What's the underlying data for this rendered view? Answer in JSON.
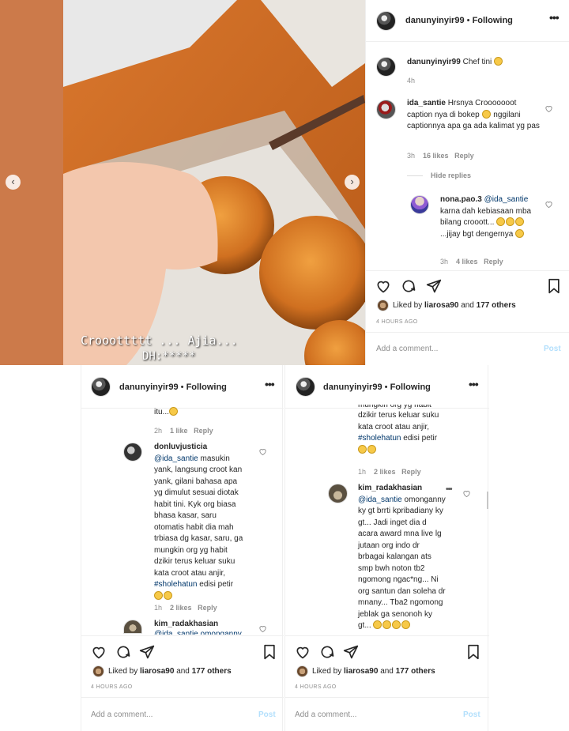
{
  "post_top": {
    "username": "danunyinyir99",
    "following": "Following",
    "separator": "•",
    "caption_user": "danunyinyir99",
    "caption": "Chef tini",
    "caption_time": "4h",
    "comment1": {
      "user": "ida_santie",
      "text": "Hrsnya Crooooooot caption nya di bokep",
      "text2": "nggilani captionnya apa ga ada kalimat yg pas",
      "time": "3h",
      "likes": "16 likes",
      "reply": "Reply"
    },
    "hide_replies": "Hide replies",
    "reply1": {
      "user": "nona.pao.3",
      "mention": "@ida_santie",
      "text": "karna dah kebiasaan mba bilang crooott...",
      "text2": "...jijay bgt dengernya",
      "time": "3h",
      "likes": "4 likes",
      "reply": "Reply"
    },
    "liked_by": "Liked by",
    "liker": "liarosa90",
    "and": "and",
    "others": "177 others",
    "time_ago": "4 HOURS AGO",
    "add_comment": "Add a comment...",
    "post": "Post"
  },
  "video": {
    "overlay_text": "Crooottttt ... Ajia...",
    "overlay_text2": "DH:*****"
  },
  "post_left": {
    "username": "danunyinyir99",
    "following": "Following",
    "separator": "•",
    "top_text": "itu...",
    "top_time": "2h",
    "top_likes": "1 like",
    "top_reply": "Reply",
    "comment": {
      "user": "donluvjusticia",
      "mention": "@ida_santie",
      "lines": [
        "masukin",
        "yank, langsung croot kan",
        "yank, gilani bahasa apa",
        "yg dimulut sesuai diotak",
        "habit tini. Kyk org biasa",
        "bhasa kasar, saru",
        "otomatis habit dia mah",
        "trbiasa dg kasar, saru, ga",
        "mungkin org yg habit",
        "dzikir terus keluar suku",
        "kata croot atau anjir,"
      ],
      "hashtag": "#sholehatun",
      "tail": "edisi petir",
      "time": "1h",
      "likes": "2 likes",
      "reply": "Reply"
    },
    "next_user": "kim_radakhasian",
    "next_partial": "@ida_santie omonganny",
    "liked_by": "Liked by",
    "liker": "liarosa90",
    "and": "and",
    "others": "177 others",
    "time_ago": "4 HOURS AGO",
    "add_comment": "Add a comment...",
    "post": "Post"
  },
  "post_right": {
    "username": "danunyinyir99",
    "following": "Following",
    "separator": "•",
    "top_lines": [
      "mungkin org yg habit",
      "dzikir terus keluar suku",
      "kata croot atau anjir,"
    ],
    "hashtag": "#sholehatun",
    "tail": "edisi petir",
    "top_time": "1h",
    "top_likes": "2 likes",
    "top_reply": "Reply",
    "comment": {
      "user": "kim_radakhasian",
      "mention": "@ida_santie",
      "lines": [
        "omonganny",
        "ky gt brrti kpribadiany ky",
        "gt... Jadi inget dia d",
        "acara award mna live lg",
        "jutaan org indo dr",
        "brbagai kalangan ats",
        "smp bwh noton tb2",
        "ngomong ngac*ng... Ni",
        "org santun dan soleha dr",
        "mnany... Tba2 ngomong",
        "jeblak ga senonoh ky",
        "gt..."
      ]
    },
    "liked_by": "Liked by",
    "liker": "liarosa90",
    "and": "and",
    "others": "177 others",
    "time_ago": "4 HOURS AGO",
    "add_comment": "Add a comment...",
    "post": "Post"
  }
}
